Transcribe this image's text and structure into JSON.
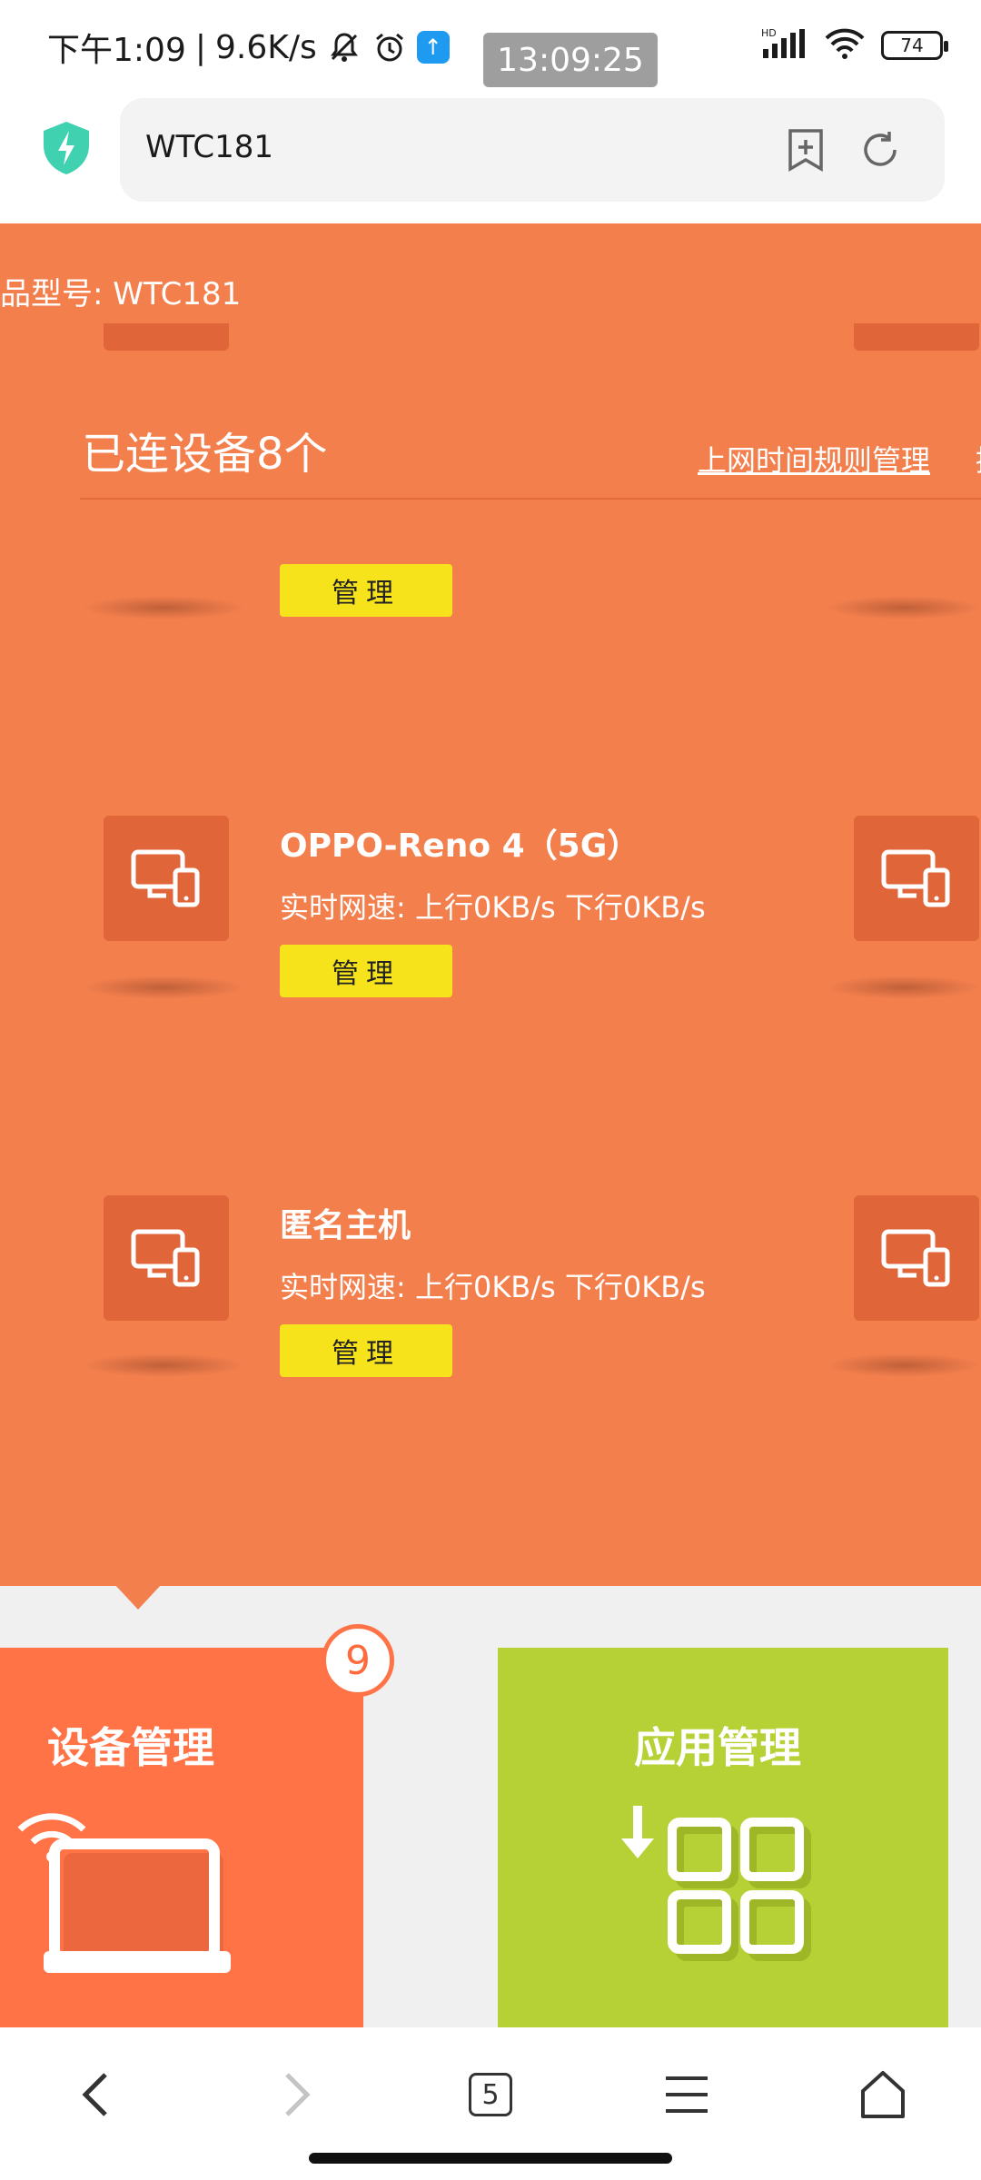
{
  "status_bar": {
    "time": "下午1:09",
    "separator": "|",
    "net_speed": "9.6K/s",
    "clock_overlay": "13:09:25",
    "network_label": "HD",
    "battery": "74"
  },
  "browser": {
    "url": "WTC181",
    "tab_count": "5"
  },
  "router": {
    "model_text": "品型号: WTC181",
    "connected_devices": "已连设备8个",
    "time_rules_link": "上网时间规则管理",
    "partial_link": "接"
  },
  "devices": [
    {
      "name": "",
      "speed": "",
      "manage_label": "管理"
    },
    {
      "name": "OPPO-Reno 4（5G）",
      "speed": "实时网速: 上行0KB/s 下行0KB/s",
      "manage_label": "管理"
    },
    {
      "name": "匿名主机",
      "speed": "实时网速: 上行0KB/s 下行0KB/s",
      "manage_label": "管理"
    }
  ],
  "tiles": {
    "device_manage": {
      "title": "设备管理",
      "badge": "9",
      "color": "#ff7347"
    },
    "app_manage": {
      "title": "应用管理",
      "color": "#b5d136"
    }
  },
  "colors": {
    "accent_orange": "#f37f4d",
    "button_yellow": "#f6e31c"
  }
}
